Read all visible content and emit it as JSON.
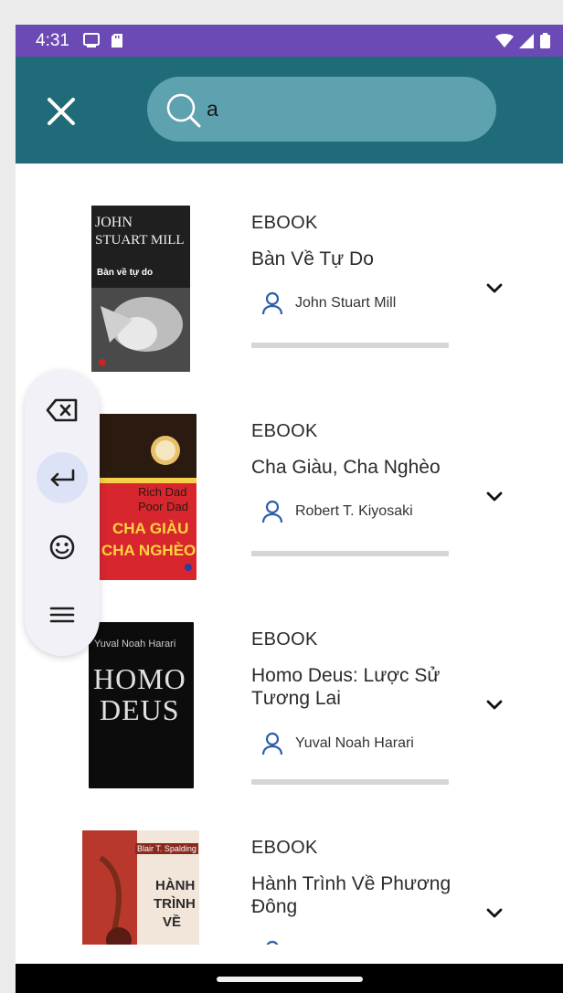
{
  "status": {
    "time": "4:31"
  },
  "search": {
    "value": "a",
    "placeholder": ""
  },
  "books": [
    {
      "type": "EBOOK",
      "title": "Bàn Về Tự Do",
      "author": "John Stuart Mill",
      "cover": {
        "top_text_1": "JOHN",
        "top_text_2": "STUART MILL",
        "mid_text": "Bàn về tự do",
        "bg": "#2a2a2a"
      }
    },
    {
      "type": "EBOOK",
      "title": "Cha Giàu, Cha Nghèo",
      "author": "Robert T. Kiyosaki",
      "cover": {
        "top_text_1": "Rich Dad",
        "top_text_2": "Poor Dad",
        "mid_text": "CHA GIÀU",
        "mid_text_2": "CHA NGHÈO",
        "bg": "#d8262e"
      }
    },
    {
      "type": "EBOOK",
      "title": "Homo Deus: Lược Sử Tương Lai",
      "author": "Yuval Noah Harari",
      "cover": {
        "top_text_1": "Yuval Noah Harari",
        "top_text_2": "HOMO",
        "mid_text": "DEUS",
        "bg": "#0c0c0c"
      }
    },
    {
      "type": "EBOOK",
      "title": "Hành Trình Về Phương Đông",
      "author": "",
      "cover": {
        "top_text_1": "Blair T. Spalding",
        "top_text_2": "HÀNH",
        "mid_text": "TRÌNH",
        "mid_text_2": "VỀ",
        "bg": "#f2e6da"
      }
    }
  ],
  "colors": {
    "status_bar": "#6c4ab6",
    "app_bar": "#1f6b7a",
    "search_pill": "#5fa2af"
  }
}
